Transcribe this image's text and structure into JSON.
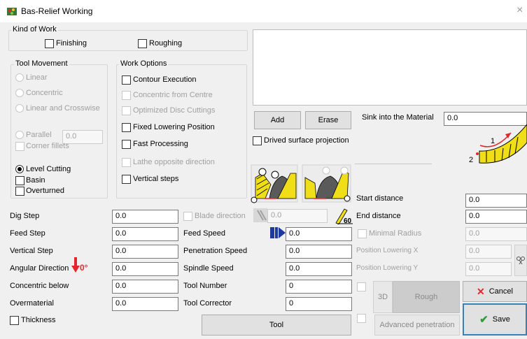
{
  "window": {
    "title": "Bas-Relief Working",
    "close": "×"
  },
  "kind_of_work": {
    "legend": "Kind of Work",
    "finishing": "Finishing",
    "roughing": "Roughing"
  },
  "tool_movement": {
    "legend": "Tool Movement",
    "linear": "Linear",
    "concentric": "Concentric",
    "linear_crosswise": "Linear and Crosswise",
    "parallel": "Parallel",
    "parallel_value": "0.0",
    "corner_fillets": "Corner fillets",
    "level_cutting": "Level Cutting",
    "basin": "Basin",
    "overturned": "Overturned"
  },
  "work_options": {
    "legend": "Work Options",
    "contour_execution": "Contour Execution",
    "concentric_from_centre": "Concentric from Centre",
    "optimized_disc": "Optimized Disc Cuttings",
    "fixed_lowering": "Fixed Lowering Position",
    "fast_processing": "Fast Processing",
    "lathe_opposite": "Lathe opposite direction",
    "vertical_steps": "Vertical steps"
  },
  "list_buttons": {
    "add": "Add",
    "erase": "Erase"
  },
  "sink": {
    "label": "Sink into the Material",
    "value": "0.0"
  },
  "drived_projection": "Drived surface projection",
  "diagram_labels": {
    "one": "1",
    "two": "2"
  },
  "left_params": [
    {
      "label": "Dig Step",
      "value": "0.0"
    },
    {
      "label": "Feed Step",
      "value": "0.0"
    },
    {
      "label": "Vertical Step",
      "value": "0.0"
    },
    {
      "label": "Angular Direction",
      "value": "0.0",
      "angle": "0°"
    },
    {
      "label": "Concentric below",
      "value": "0.0"
    },
    {
      "label": "Overmaterial",
      "value": "0.0"
    }
  ],
  "thickness": "Thickness",
  "mid_params": {
    "blade_direction": "Blade direction",
    "blade_value": "0.0",
    "angle_value": "60",
    "feed_speed": "Feed Speed",
    "feed_value": "0.0",
    "penetration_speed": "Penetration Speed",
    "penetration_value": "0.0",
    "spindle_speed": "Spindle Speed",
    "spindle_value": "0.0",
    "tool_number": "Tool Number",
    "tool_number_value": "0",
    "tool_corrector": "Tool Corrector",
    "tool_corrector_value": "0"
  },
  "tool_button": "Tool",
  "right_params": {
    "start_distance": "Start distance",
    "start_value": "0.0",
    "end_distance": "End distance",
    "end_value": "0.0",
    "minimal_radius": "Minimal Radius",
    "minimal_value": "0.0",
    "pos_lowering_x": "Position Lowering X",
    "pos_x_value": "0.0",
    "pos_lowering_y": "Position Lowering Y",
    "pos_y_value": "0.0"
  },
  "bottom_buttons": {
    "three_d": "3D",
    "rough": "Rough",
    "advanced": "Advanced penetration",
    "cancel": "Cancel",
    "save": "Save"
  },
  "colors": {
    "accent_red": "#e4262c",
    "save_border": "#3c7fb1",
    "save_check": "#2e9c3a",
    "tool_yellow": "#f0de18"
  }
}
